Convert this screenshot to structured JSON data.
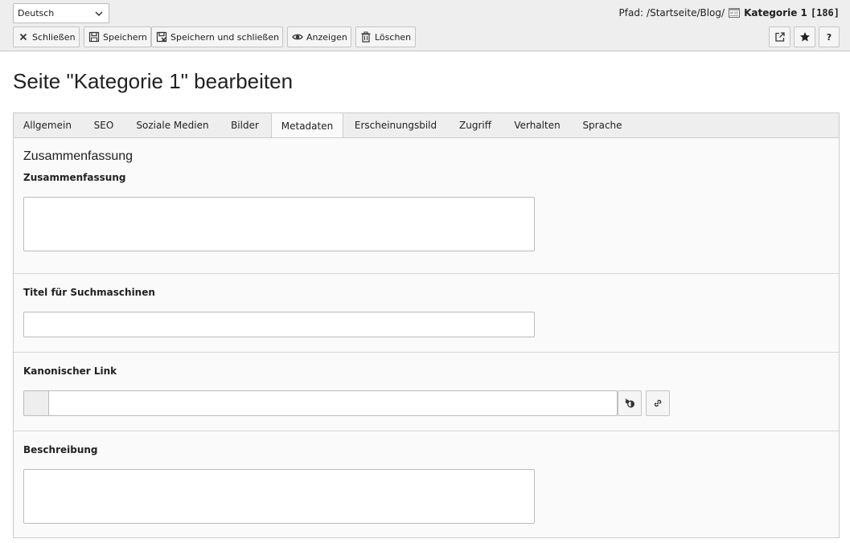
{
  "docheader": {
    "language": "Deutsch",
    "path_label": "Pfad:",
    "path": "/Startseite/Blog/",
    "page_title": "Kategorie 1",
    "page_uid": "[186]",
    "buttons": {
      "close": "Schließen",
      "save": "Speichern",
      "save_close": "Speichern und schließen",
      "view": "Anzeigen",
      "delete": "Löschen"
    }
  },
  "main": {
    "title": "Seite \"Kategorie 1\" bearbeiten",
    "tabs": [
      {
        "label": "Allgemein"
      },
      {
        "label": "SEO"
      },
      {
        "label": "Soziale Medien"
      },
      {
        "label": "Bilder"
      },
      {
        "label": "Metadaten",
        "active": true
      },
      {
        "label": "Erscheinungsbild"
      },
      {
        "label": "Zugriff"
      },
      {
        "label": "Verhalten"
      },
      {
        "label": "Sprache"
      }
    ],
    "sections": {
      "summary": {
        "title": "Zusammenfassung",
        "field_label": "Zusammenfassung",
        "value": ""
      },
      "seo_title": {
        "field_label": "Titel für Suchmaschinen",
        "value": ""
      },
      "canonical": {
        "field_label": "Kanonischer Link",
        "value": ""
      },
      "description": {
        "field_label": "Beschreibung",
        "value": ""
      }
    }
  },
  "colors": {
    "header_bg": "#eeeeee",
    "panel_bg": "#fafafa",
    "border": "#cccccc"
  }
}
